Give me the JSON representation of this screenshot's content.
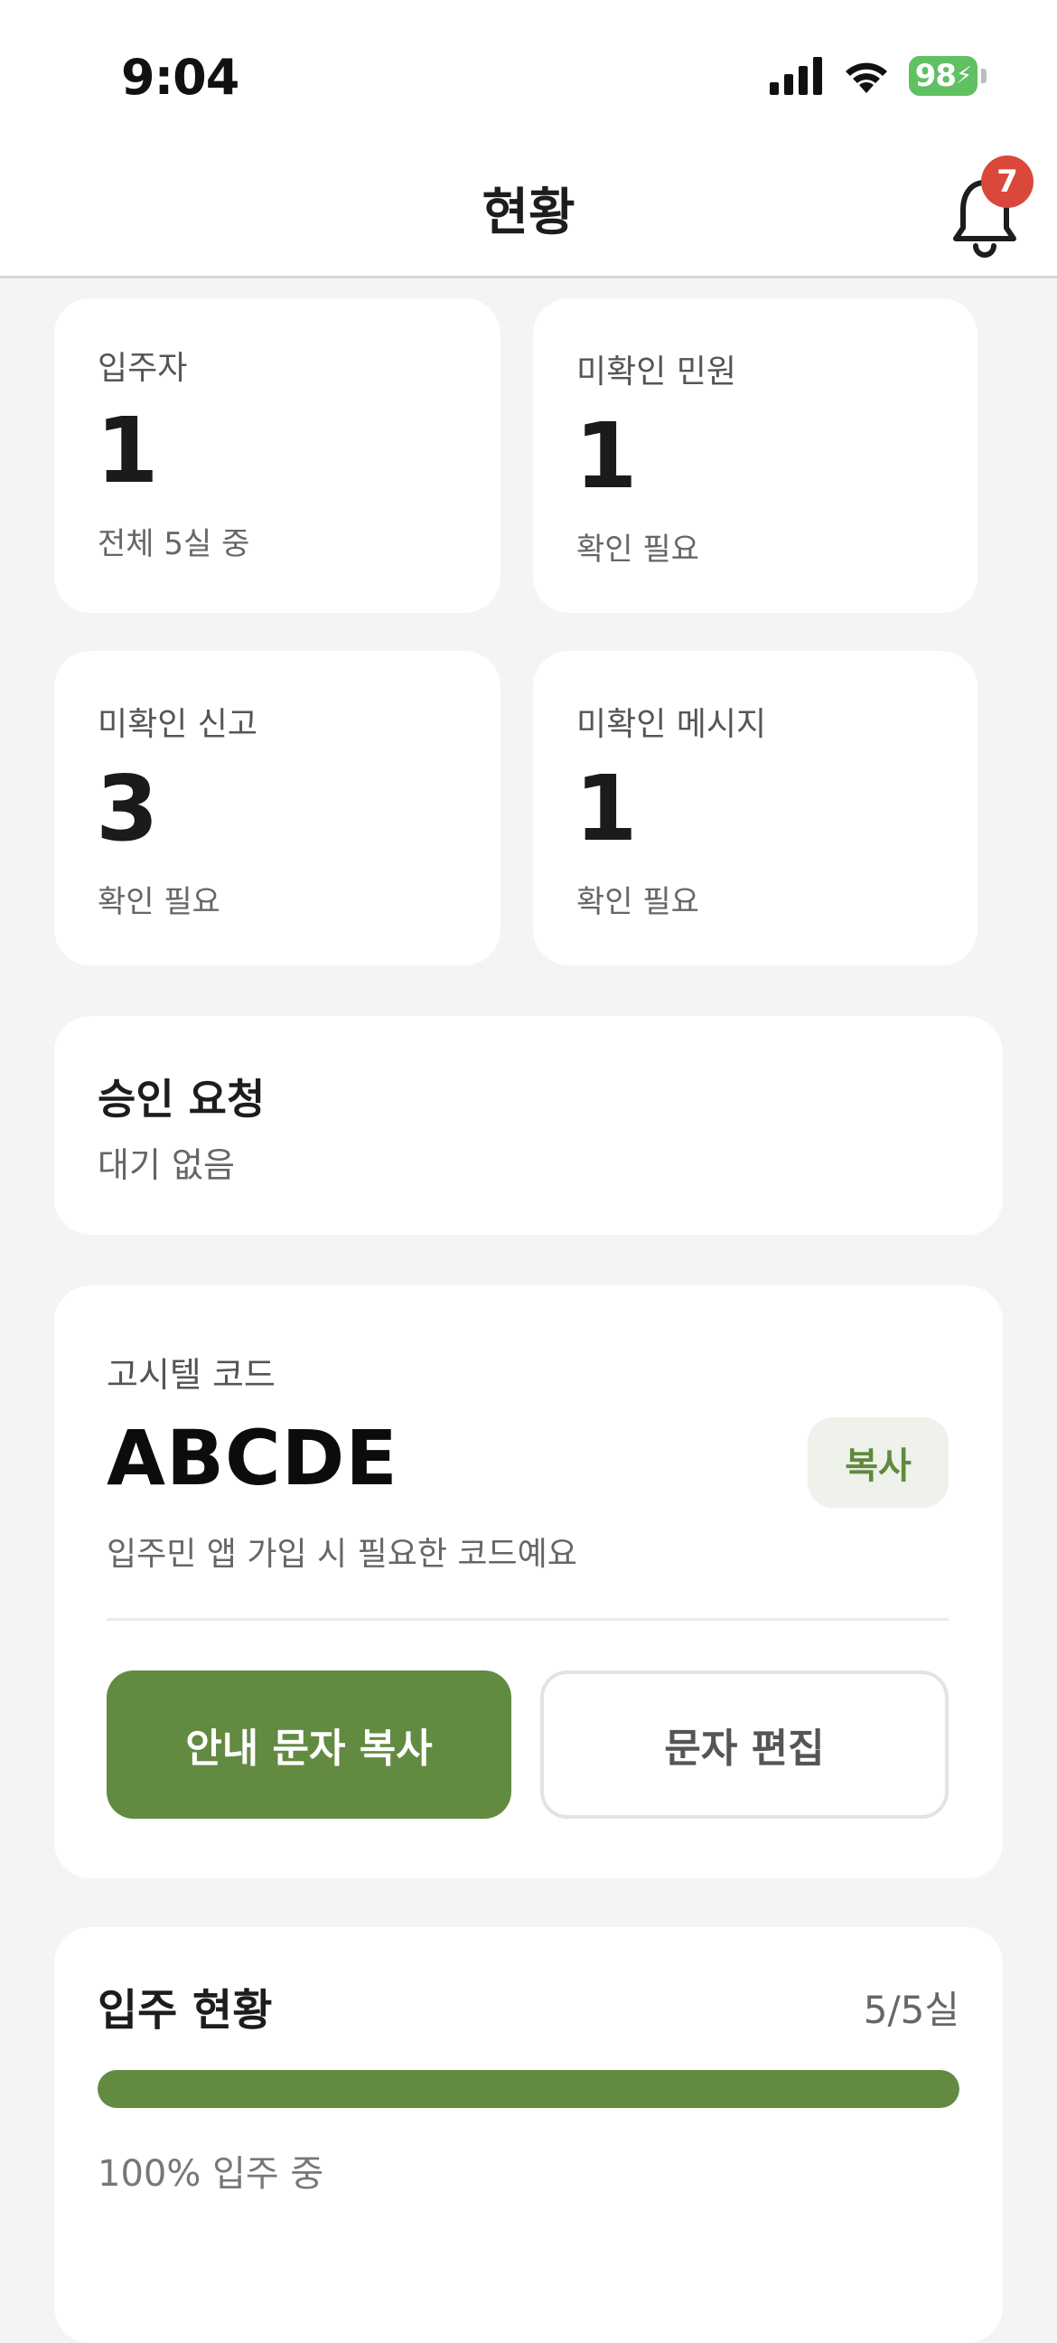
{
  "status_bar": {
    "time": "9:04",
    "battery": "98"
  },
  "header": {
    "title": "현황",
    "notification_count": "7"
  },
  "stats": [
    {
      "label": "입주자",
      "value": "1",
      "sub": "전체 5실 중"
    },
    {
      "label": "미확인 민원",
      "value": "1",
      "sub": "확인 필요"
    },
    {
      "label": "미확인 신고",
      "value": "3",
      "sub": "확인 필요"
    },
    {
      "label": "미확인 메시지",
      "value": "1",
      "sub": "확인 필요"
    }
  ],
  "approval": {
    "title": "승인 요청",
    "subtitle": "대기 없음"
  },
  "code_card": {
    "label": "고시텔 코드",
    "code": "ABCDE",
    "copy_label": "복사",
    "description": "입주민 앱 가입 시 필요한 코드예요",
    "primary_button": "안내 문자 복사",
    "secondary_button": "문자 편집"
  },
  "occupancy": {
    "title": "입주 현황",
    "count": "5/5실",
    "percent": 100,
    "subtitle": "100% 입주 중"
  },
  "colors": {
    "accent": "#628a41",
    "badge": "#d9483b",
    "battery": "#5fc161"
  }
}
